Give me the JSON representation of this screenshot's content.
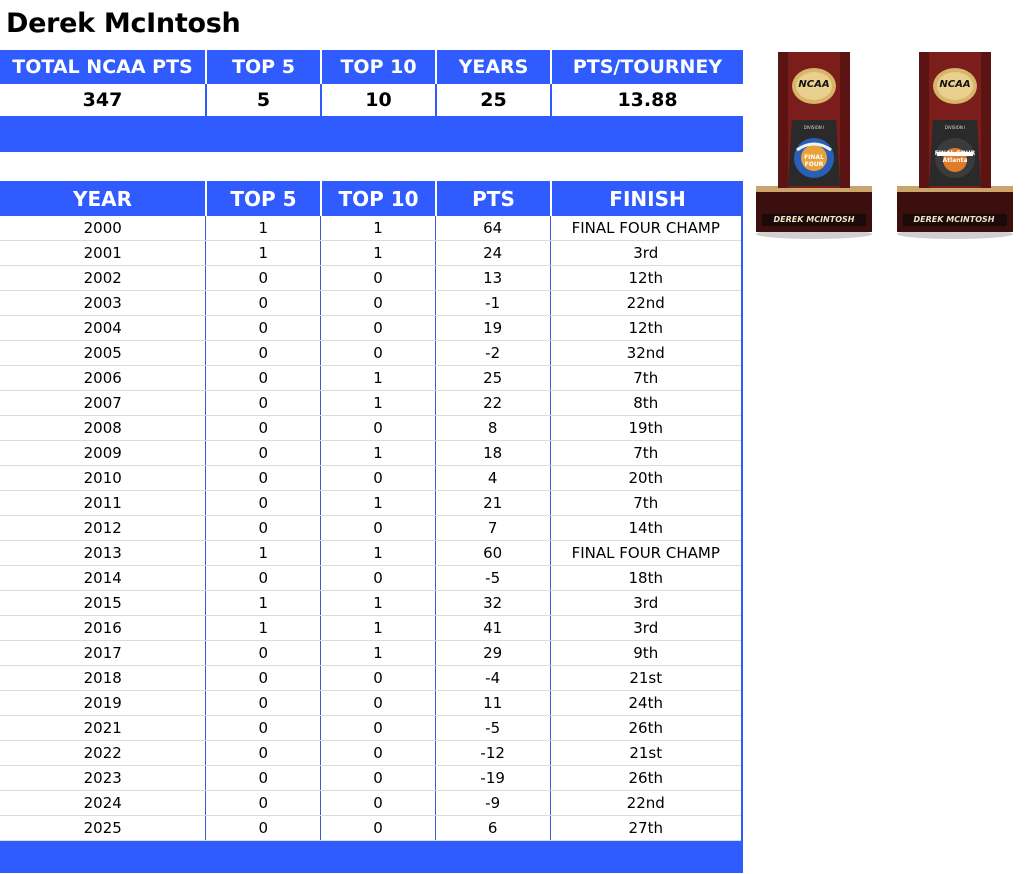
{
  "title": "Derek McIntosh",
  "summary": {
    "headers": [
      "TOTAL NCAA PTS",
      "TOP 5",
      "TOP 10",
      "YEARS",
      "PTS/TOURNEY"
    ],
    "values": [
      "347",
      "5",
      "10",
      "25",
      "13.88"
    ]
  },
  "results": {
    "headers": [
      "YEAR",
      "TOP 5",
      "TOP 10",
      "PTS",
      "FINISH"
    ],
    "rows": [
      [
        "2000",
        "1",
        "1",
        "64",
        "FINAL FOUR CHAMP"
      ],
      [
        "2001",
        "1",
        "1",
        "24",
        "3rd"
      ],
      [
        "2002",
        "0",
        "0",
        "13",
        "12th"
      ],
      [
        "2003",
        "0",
        "0",
        "-1",
        "22nd"
      ],
      [
        "2004",
        "0",
        "0",
        "19",
        "12th"
      ],
      [
        "2005",
        "0",
        "0",
        "-2",
        "32nd"
      ],
      [
        "2006",
        "0",
        "1",
        "25",
        "7th"
      ],
      [
        "2007",
        "0",
        "1",
        "22",
        "8th"
      ],
      [
        "2008",
        "0",
        "0",
        "8",
        "19th"
      ],
      [
        "2009",
        "0",
        "1",
        "18",
        "7th"
      ],
      [
        "2010",
        "0",
        "0",
        "4",
        "20th"
      ],
      [
        "2011",
        "0",
        "1",
        "21",
        "7th"
      ],
      [
        "2012",
        "0",
        "0",
        "7",
        "14th"
      ],
      [
        "2013",
        "1",
        "1",
        "60",
        "FINAL FOUR CHAMP"
      ],
      [
        "2014",
        "0",
        "0",
        "-5",
        "18th"
      ],
      [
        "2015",
        "1",
        "1",
        "32",
        "3rd"
      ],
      [
        "2016",
        "1",
        "1",
        "41",
        "3rd"
      ],
      [
        "2017",
        "0",
        "1",
        "29",
        "9th"
      ],
      [
        "2018",
        "0",
        "0",
        "-4",
        "21st"
      ],
      [
        "2019",
        "0",
        "0",
        "11",
        "24th"
      ],
      [
        "2021",
        "0",
        "0",
        "-5",
        "26th"
      ],
      [
        "2022",
        "0",
        "0",
        "-12",
        "21st"
      ],
      [
        "2023",
        "0",
        "0",
        "-19",
        "26th"
      ],
      [
        "2024",
        "0",
        "0",
        "-9",
        "22nd"
      ],
      [
        "2025",
        "0",
        "0",
        "6",
        "27th"
      ]
    ]
  },
  "trophies": [
    {
      "brand": "NCAA",
      "division": "DIVISION I",
      "event": "FINAL FOUR",
      "nameplate": "DEREK MCINTOSH"
    },
    {
      "brand": "NCAA",
      "division": "DIVISION I",
      "event": "FINAL FOUR Atlanta",
      "nameplate": "DEREK MCINTOSH"
    }
  ],
  "colors": {
    "header_blue": "#2f5bff",
    "trophy_wood": "#7a1d1b",
    "trophy_gold": "#d8b56a"
  }
}
